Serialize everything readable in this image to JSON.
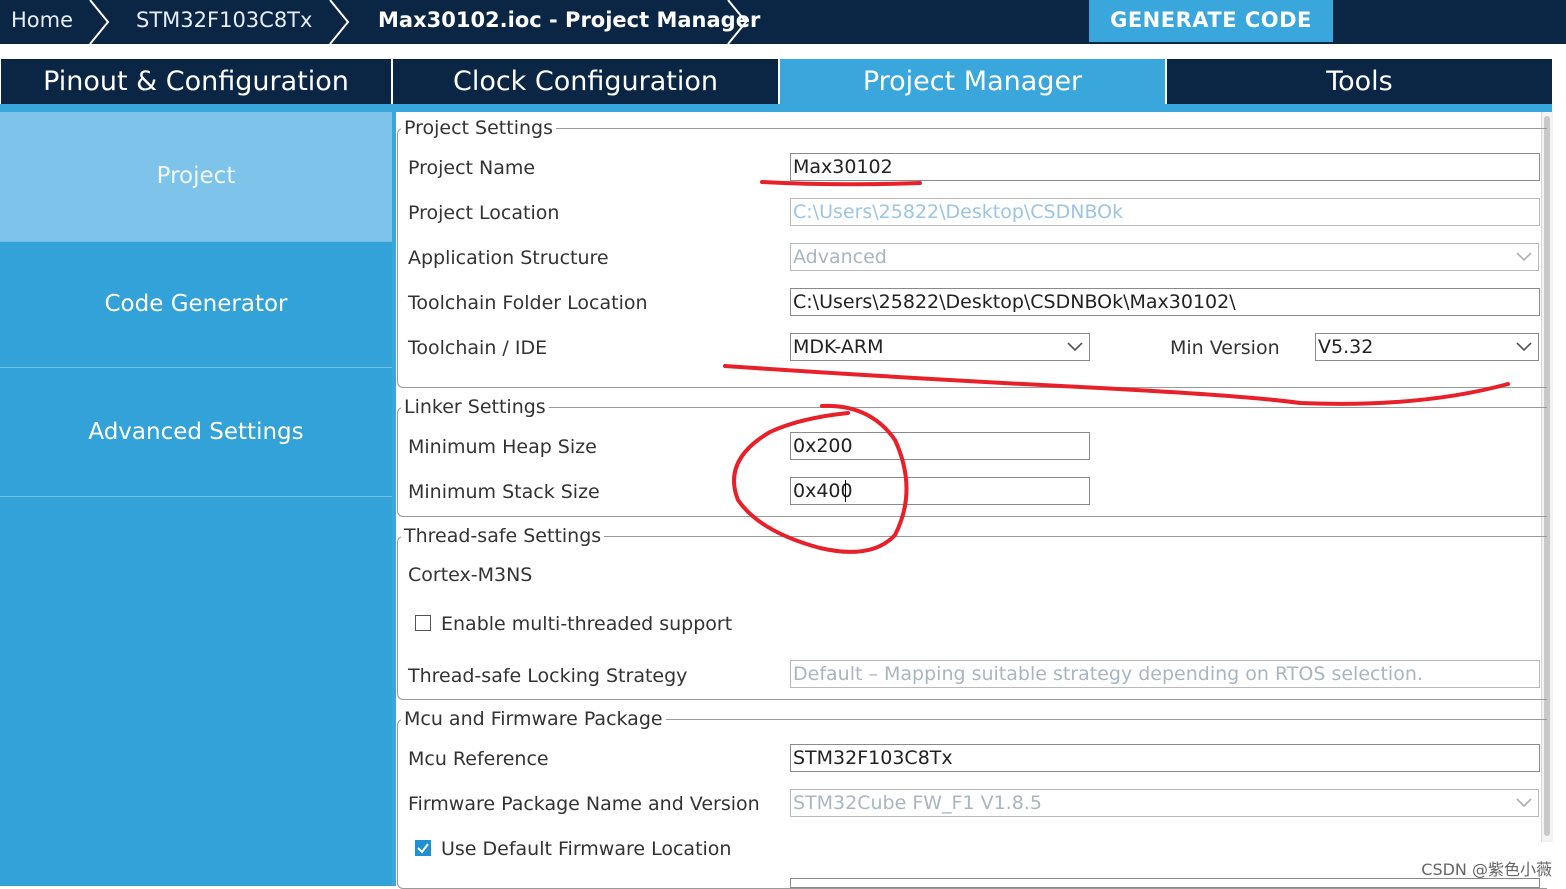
{
  "breadcrumb": {
    "home": "Home",
    "mcu": "STM32F103C8Tx",
    "file": "Max30102.ioc - Project Manager"
  },
  "toolbar": {
    "generate_label": "GENERATE CODE"
  },
  "tabs": [
    {
      "label": "Pinout & Configuration"
    },
    {
      "label": "Clock Configuration"
    },
    {
      "label": "Project Manager"
    },
    {
      "label": "Tools"
    }
  ],
  "sidebar": {
    "items": [
      {
        "label": "Project"
      },
      {
        "label": "Code Generator"
      },
      {
        "label": "Advanced Settings"
      }
    ]
  },
  "project_settings": {
    "title": "Project Settings",
    "project_name_label": "Project Name",
    "project_name_value": "Max30102",
    "project_location_label": "Project Location",
    "project_location_value": "C:\\Users\\25822\\Desktop\\CSDNBOk",
    "app_structure_label": "Application Structure",
    "app_structure_value": "Advanced",
    "toolchain_folder_label": "Toolchain Folder Location",
    "toolchain_folder_value": "C:\\Users\\25822\\Desktop\\CSDNBOk\\Max30102\\",
    "toolchain_ide_label": "Toolchain / IDE",
    "toolchain_ide_value": "MDK-ARM",
    "min_version_label": "Min Version",
    "min_version_value": "V5.32"
  },
  "linker_settings": {
    "title": "Linker Settings",
    "heap_label": "Minimum Heap Size",
    "heap_value": "0x200",
    "stack_label": "Minimum Stack Size",
    "stack_value": "0x400"
  },
  "thread_safe": {
    "title": "Thread-safe Settings",
    "core_label": "Cortex-M3NS",
    "multithread_label": "Enable multi-threaded support",
    "multithread_checked": false,
    "locking_label": "Thread-safe Locking Strategy",
    "locking_value": "Default  –  Mapping suitable strategy depending on RTOS selection."
  },
  "mcu_firmware": {
    "title": "Mcu and Firmware Package",
    "mcu_ref_label": "Mcu Reference",
    "mcu_ref_value": "STM32F103C8Tx",
    "fw_label": "Firmware Package Name and Version",
    "fw_value": "STM32Cube FW_F1 V1.8.5",
    "default_fw_label": "Use Default Firmware Location",
    "default_fw_checked": true
  },
  "watermark": "CSDN @紫色小薇",
  "colors": {
    "dark_navy": "#0b2545",
    "accent_blue": "#3aa7dc",
    "annotation_red": "#e8202a"
  }
}
